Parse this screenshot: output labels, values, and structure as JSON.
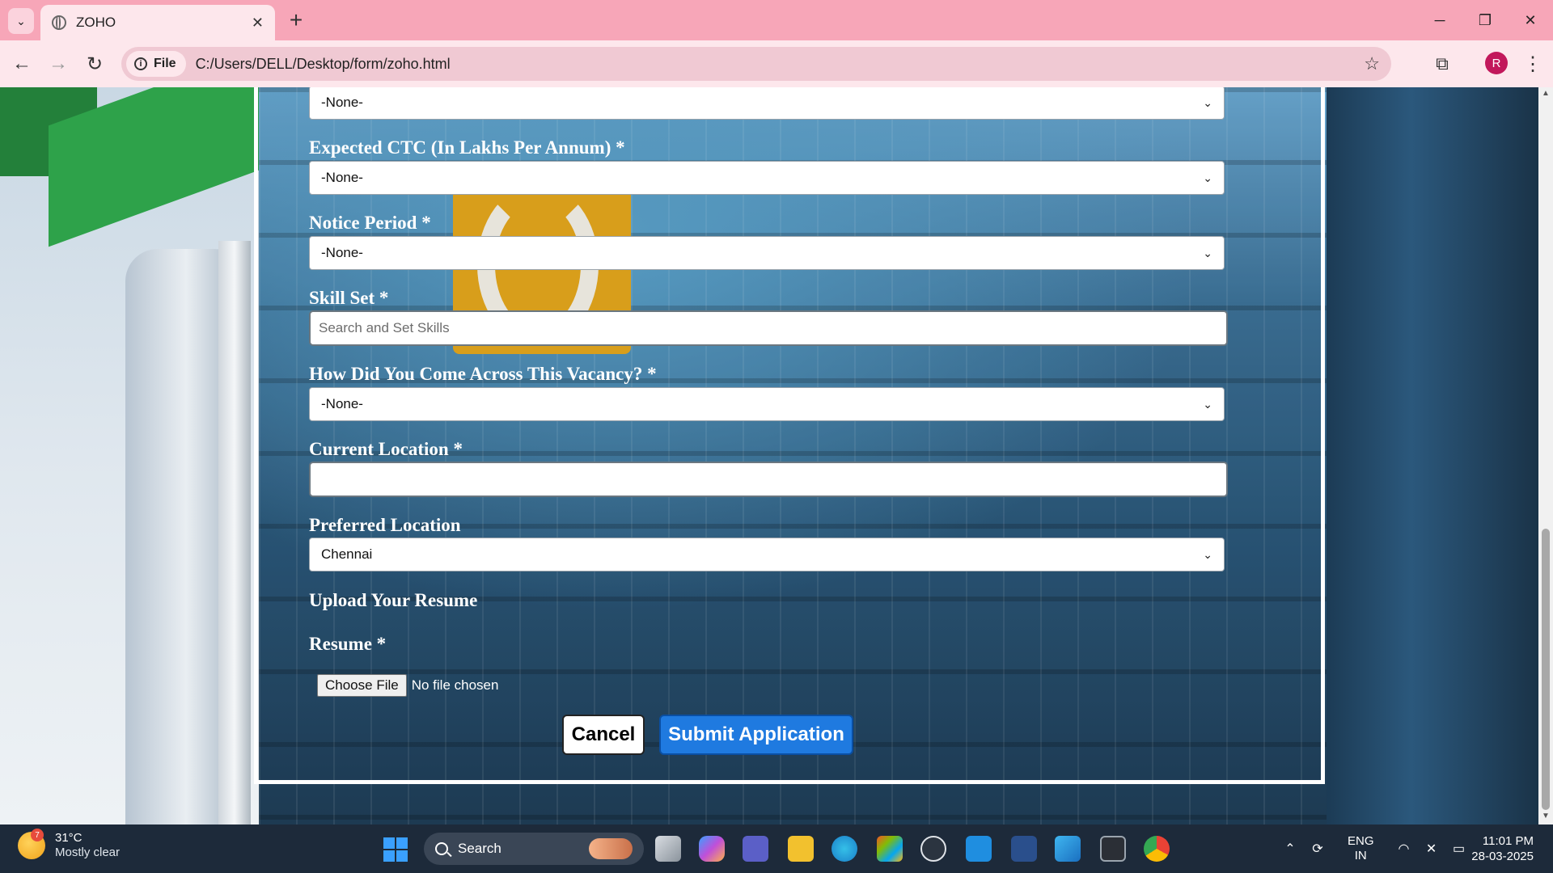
{
  "browser": {
    "tab_title": "ZOHO",
    "site_chip": "File",
    "url": "C:/Users/DELL/Desktop/form/zoho.html",
    "profile_initial": "R"
  },
  "form": {
    "top_select_value": "-None-",
    "expected_ctc": {
      "label": "Expected CTC (In Lakhs Per Annum) *",
      "value": "-None-"
    },
    "notice_period": {
      "label": "Notice Period *",
      "value": "-None-"
    },
    "skill_set": {
      "label": "Skill Set *",
      "placeholder": "Search and Set Skills"
    },
    "vacancy_source": {
      "label": "How Did You Come Across This Vacancy? *",
      "value": "-None-"
    },
    "current_location": {
      "label": "Current Location *",
      "value": ""
    },
    "preferred_location": {
      "label": "Preferred Location",
      "value": "Chennai"
    },
    "upload_section_title": "Upload Your Resume",
    "resume": {
      "label": "Resume *",
      "button": "Choose File",
      "status": "No file chosen"
    },
    "cancel_label": "Cancel",
    "submit_label": "Submit Application"
  },
  "taskbar": {
    "weather_temp": "31°C",
    "weather_desc": "Mostly clear",
    "weather_badge": "7",
    "search_label": "Search",
    "lang_top": "ENG",
    "lang_bottom": "IN",
    "time": "11:01 PM",
    "date": "28-03-2025"
  },
  "colors": {
    "tab_bar": "#f7a6b8",
    "toolbar": "#fde7ec",
    "submit_button": "#1f7ae0",
    "taskbar": "#1d2a3a"
  }
}
